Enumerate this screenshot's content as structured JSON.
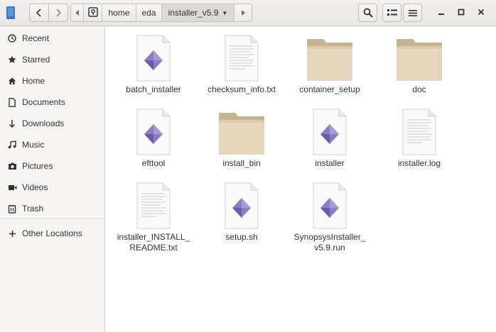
{
  "header": {
    "path": {
      "segments": [
        "home",
        "eda"
      ],
      "current": "installer_v5.9"
    },
    "icons": {
      "back": "chevron-left-icon",
      "forward": "chevron-right-icon",
      "search": "search-icon",
      "view": "list-view-icon",
      "menu": "hamburger-menu-icon"
    }
  },
  "sidebar": {
    "items": [
      {
        "label": "Recent",
        "icon": "clock-icon"
      },
      {
        "label": "Starred",
        "icon": "star-icon"
      },
      {
        "label": "Home",
        "icon": "home-icon"
      },
      {
        "label": "Documents",
        "icon": "document-icon"
      },
      {
        "label": "Downloads",
        "icon": "download-icon"
      },
      {
        "label": "Music",
        "icon": "music-icon"
      },
      {
        "label": "Pictures",
        "icon": "camera-icon"
      },
      {
        "label": "Videos",
        "icon": "video-icon"
      },
      {
        "label": "Trash",
        "icon": "trash-icon"
      }
    ],
    "other": {
      "label": "Other Locations",
      "icon": "plus-icon"
    }
  },
  "files": [
    {
      "name": "batch_installer",
      "type": "executable"
    },
    {
      "name": "checksum_info.txt",
      "type": "text"
    },
    {
      "name": "container_setup",
      "type": "folder"
    },
    {
      "name": "doc",
      "type": "folder"
    },
    {
      "name": "efttool",
      "type": "executable"
    },
    {
      "name": "install_bin",
      "type": "folder"
    },
    {
      "name": "installer",
      "type": "executable"
    },
    {
      "name": "installer.log",
      "type": "text"
    },
    {
      "name": "installer_INSTALL_\nREADME.txt",
      "type": "text"
    },
    {
      "name": "setup.sh",
      "type": "executable"
    },
    {
      "name": "SynopsysInstaller_\nv5.9.run",
      "type": "executable"
    }
  ],
  "colors": {
    "folder": "#d8c8a9",
    "folder_tab": "#c5b293",
    "exec_diamond": "#8e7cc3",
    "exec_diamond_dark": "#6c5ba8"
  }
}
